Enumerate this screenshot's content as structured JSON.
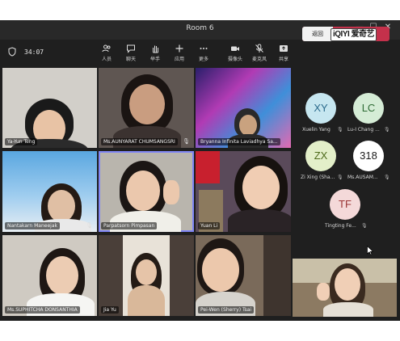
{
  "window": {
    "title": "Room 6",
    "controls": [
      "—",
      "☐",
      "✕"
    ]
  },
  "toolbar": {
    "timer": "34:07",
    "buttons": [
      {
        "label": "人员",
        "icon": "people-icon"
      },
      {
        "label": "聊天",
        "icon": "chat-icon"
      },
      {
        "label": "举手",
        "icon": "raise-hand-icon"
      },
      {
        "label": "应用",
        "icon": "apps-icon"
      },
      {
        "label": "更多",
        "icon": "more-icon"
      },
      {
        "label": "摄像头",
        "icon": "camera-icon"
      },
      {
        "label": "麦克风",
        "icon": "microphone-icon"
      },
      {
        "label": "共享",
        "icon": "share-icon"
      }
    ],
    "return_label": "返回",
    "watermark": "iQIYI 爱奇艺",
    "leave_label": "离开"
  },
  "participants": [
    {
      "name": "Ya-Yun Teng"
    },
    {
      "name": "Ms.AUNYARAT CHUMSANGSRI"
    },
    {
      "name": "Bryanna Infinita Laviadhya Sa..."
    },
    {
      "name": "Nantakarn Maneejak"
    },
    {
      "name": "Parpatsorn Pimpasan"
    },
    {
      "name": "Yuan Li"
    },
    {
      "name": "Ms.SUPHITCHA DONSANTHIA"
    },
    {
      "name": "Jia Yu"
    },
    {
      "name": "Pei-Wen (Sherry) Tsai"
    }
  ],
  "roster": [
    {
      "initials": "XY",
      "name": "Xuelin Yang",
      "bg": "#c6e6f0",
      "fg": "#2b6a8c"
    },
    {
      "initials": "LC",
      "name": "Lu-I Chang ...",
      "bg": "#d5ecd6",
      "fg": "#2e6b35"
    },
    {
      "initials": "ZX",
      "name": "Zi Xing (Sha...",
      "bg": "#e3efc9",
      "fg": "#4f6b1c"
    },
    {
      "initials": "318",
      "name": "Ms.AUSAM...",
      "bg": "#ffffff",
      "fg": "#1a1a1a"
    },
    {
      "initials": "TF",
      "name": "Tingting Fe...",
      "bg": "#f4d9d9",
      "fg": "#9a3434"
    }
  ],
  "colors": {
    "accent": "#7f85f5",
    "leave": "#c4314b",
    "background": "#1f1f1f"
  }
}
